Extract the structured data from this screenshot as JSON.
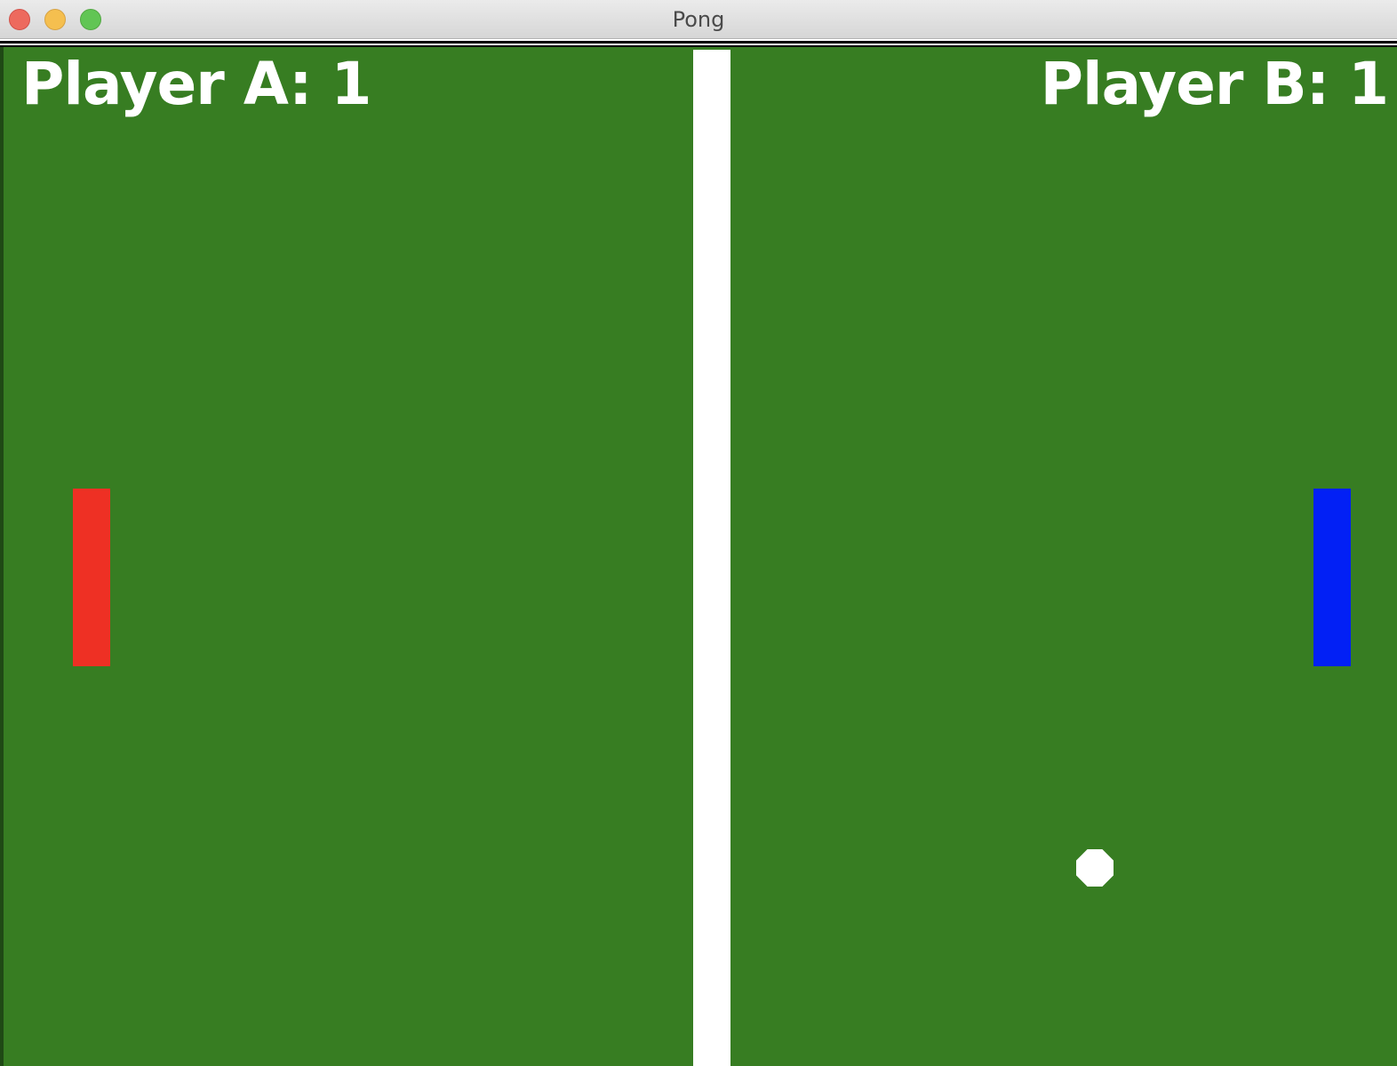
{
  "window": {
    "title": "Pong"
  },
  "game": {
    "background_color": "#377d22",
    "net_color": "#ffffff",
    "score_a_label": "Player A: 1",
    "score_b_label": "Player B: 1",
    "paddle_a_color": "#ee3024",
    "paddle_b_color": "#0220f5",
    "ball_color": "#ffffff"
  }
}
